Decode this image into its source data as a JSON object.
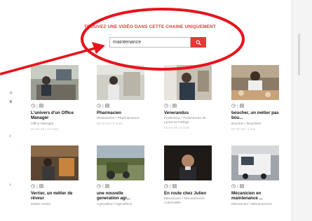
{
  "headline": "TROUVEZ UNE VIDÉO DANS CETTE CHAINE UNIQUEMENT",
  "search": {
    "value": "maintenance",
    "button_icon": "search-icon"
  },
  "left_text": [
    "o.",
    "il",
    "i",
    "i"
  ],
  "colors": {
    "accent": "#e53935",
    "annotation": "#e8121b"
  },
  "videos": [
    {
      "title": "L'univers d'un Office Manager",
      "category": "Office Manager",
      "detail": "02 mn 44 | 12 vues"
    },
    {
      "title": "Pharmacien",
      "category": "Pharmacien / Pharmacienne",
      "detail": "02 mn 20 | 6 vues"
    },
    {
      "title": "Venerandus",
      "category": "Professeur / Professeure de Lycée et Collège",
      "detail": "02 mn 05 | 5 vues"
    },
    {
      "title": "boucher, un métier pas bou...",
      "category": "Boucher / Bouchère",
      "detail": "02 mn 08 | 1 vue"
    },
    {
      "title": "Verrier, un métier de rêveur",
      "category": "Maître verrier",
      "detail": ""
    },
    {
      "title": "une nouvelle generation agr...",
      "category": "Agriculteur / Agricultrice",
      "detail": ""
    },
    {
      "title": "En route chez Julien",
      "category": "Mécanicien / Mécanicienne Automobile",
      "detail": ""
    },
    {
      "title": "Mécanicien en maintenance ...",
      "category": "Mécanicien / Mécanicienne",
      "detail": ""
    }
  ]
}
